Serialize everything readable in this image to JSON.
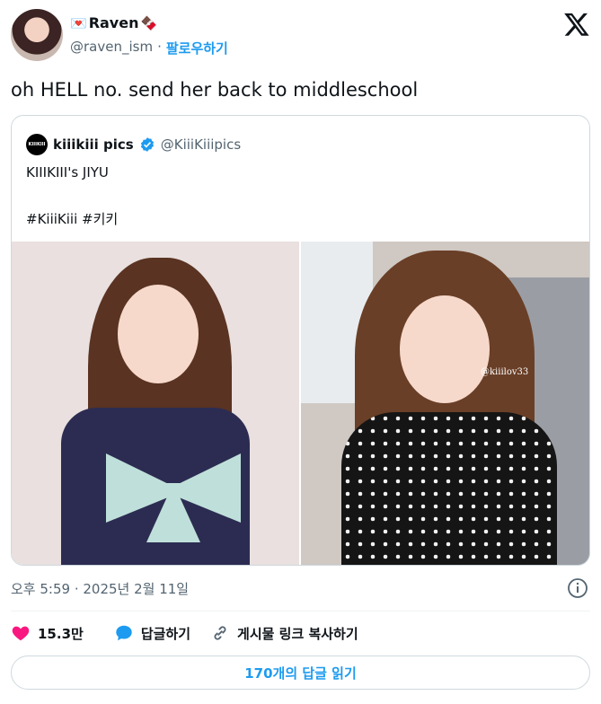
{
  "author": {
    "display_name": "Raven",
    "emoji_left": "💌",
    "emoji_right": "🍫",
    "handle": "@raven_ism",
    "separator": "·",
    "follow_label": "팔로우하기"
  },
  "tweet": {
    "text": "oh HELL no. send her back to middleschool"
  },
  "quoted": {
    "avatar_text": "KIIIKIII",
    "name": "kiiikiii pics",
    "handle": "@KiiiKiiipics",
    "line1": "KIIIKIII's JIYU",
    "line2": "#KiiiKiii #키키",
    "watermark": "@kiiilov33"
  },
  "meta": {
    "timestamp": "오후 5:59 · 2025년 2월 11일"
  },
  "actions": {
    "likes": "15.3만",
    "reply_label": "답글하기",
    "copy_link_label": "게시물 링크 복사하기"
  },
  "read_replies_label": "170개의 답글 읽기",
  "colors": {
    "accent": "#1d9bf0",
    "like": "#f91880",
    "text": "#0f1419",
    "muted": "#536471"
  }
}
